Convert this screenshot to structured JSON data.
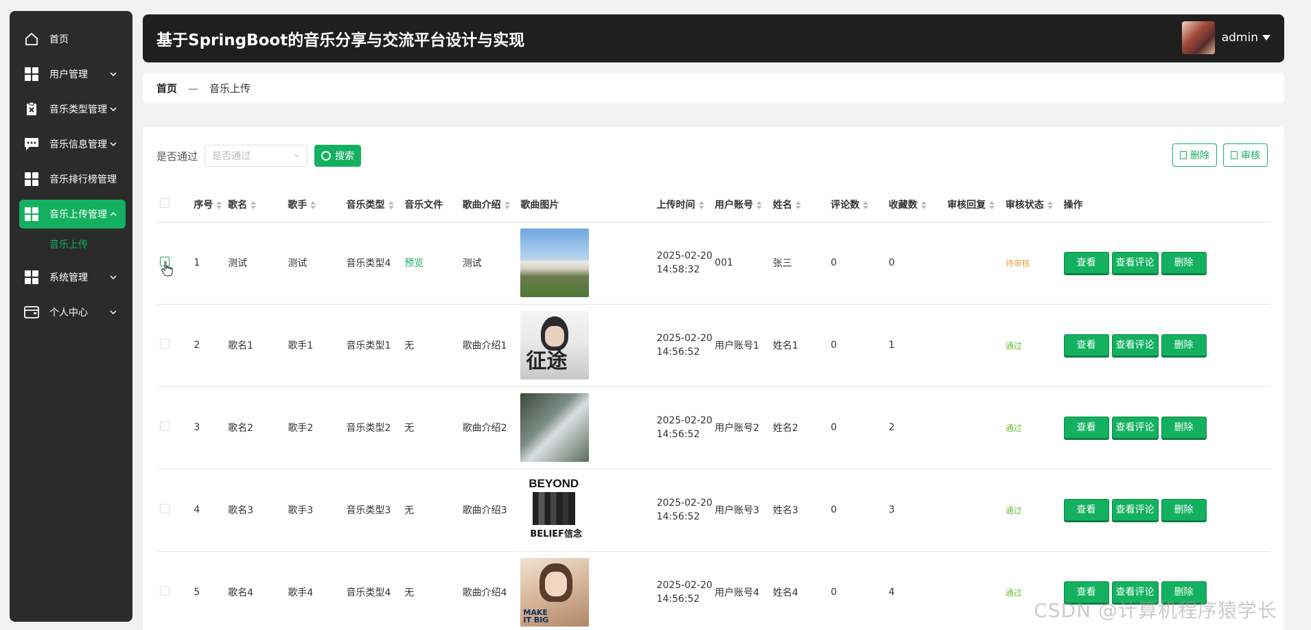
{
  "app": {
    "title": "基于SpringBoot的音乐分享与交流平台设计与实现"
  },
  "user": {
    "name": "admin"
  },
  "sidebar": {
    "items": [
      {
        "label": "首页",
        "icon": "home-icon"
      },
      {
        "label": "用户管理",
        "icon": "grid-icon"
      },
      {
        "label": "音乐类型管理",
        "icon": "clipboard-icon"
      },
      {
        "label": "音乐信息管理",
        "icon": "chat-icon"
      },
      {
        "label": "音乐排行榜管理",
        "icon": "grid-icon"
      },
      {
        "label": "音乐上传管理",
        "icon": "grid-icon",
        "active": true
      },
      {
        "label": "系统管理",
        "icon": "grid-icon"
      },
      {
        "label": "个人中心",
        "icon": "wallet-icon"
      }
    ],
    "sub_item": "音乐上传",
    "accent": "#13b15f"
  },
  "breadcrumb": {
    "home": "首页",
    "separator": "—",
    "current": "音乐上传"
  },
  "filter": {
    "label": "是否通过",
    "placeholder": "是否通过",
    "search_button": "搜索"
  },
  "toolbar": {
    "delete_label": "删除",
    "audit_label": "审核"
  },
  "table": {
    "headers": [
      "序号",
      "歌名",
      "歌手",
      "音乐类型",
      "音乐文件",
      "歌曲介绍",
      "歌曲图片",
      "上传时间",
      "用户账号",
      "姓名",
      "评论数",
      "收藏数",
      "审核回复",
      "审核状态",
      "操作"
    ],
    "rows": [
      {
        "index": "1",
        "name": "测试",
        "singer": "测试",
        "type": "音乐类型4",
        "file": "预览",
        "intro": "测试",
        "date": "2025-02-20",
        "time": "14:58:32",
        "account": "001",
        "real_name": "张三",
        "comments": "0",
        "favorites": "0",
        "reply": "",
        "status": "待审核",
        "status_color": "#e6a23c"
      },
      {
        "index": "2",
        "name": "歌名1",
        "singer": "歌手1",
        "type": "音乐类型1",
        "file": "无",
        "intro": "歌曲介绍1",
        "date": "2025-02-20",
        "time": "14:56:52",
        "account": "用户账号1",
        "real_name": "姓名1",
        "comments": "0",
        "favorites": "1",
        "reply": "",
        "status": "通过",
        "status_color": "#67c23a"
      },
      {
        "index": "3",
        "name": "歌名2",
        "singer": "歌手2",
        "type": "音乐类型2",
        "file": "无",
        "intro": "歌曲介绍2",
        "date": "2025-02-20",
        "time": "14:56:52",
        "account": "用户账号2",
        "real_name": "姓名2",
        "comments": "0",
        "favorites": "2",
        "reply": "",
        "status": "通过",
        "status_color": "#67c23a"
      },
      {
        "index": "4",
        "name": "歌名3",
        "singer": "歌手3",
        "type": "音乐类型3",
        "file": "无",
        "intro": "歌曲介绍3",
        "date": "2025-02-20",
        "time": "14:56:52",
        "account": "用户账号3",
        "real_name": "姓名3",
        "comments": "0",
        "favorites": "3",
        "reply": "",
        "status": "通过",
        "status_color": "#67c23a"
      },
      {
        "index": "5",
        "name": "歌名4",
        "singer": "歌手4",
        "type": "音乐类型4",
        "file": "无",
        "intro": "歌曲介绍4",
        "date": "2025-02-20",
        "time": "14:56:52",
        "account": "用户账号4",
        "real_name": "姓名4",
        "comments": "0",
        "favorites": "4",
        "reply": "",
        "status": "通过",
        "status_color": "#67c23a"
      }
    ],
    "row_actions": {
      "view": "查看",
      "view_comments": "查看评论",
      "delete": "删除"
    },
    "image_texts": {
      "row2": "征途",
      "row4_top": "BEYOND",
      "row4_bottom": "BELIEF信念",
      "row5": "MAKE IT BIG"
    }
  },
  "watermark": "CSDN @计算机程序猿学长"
}
